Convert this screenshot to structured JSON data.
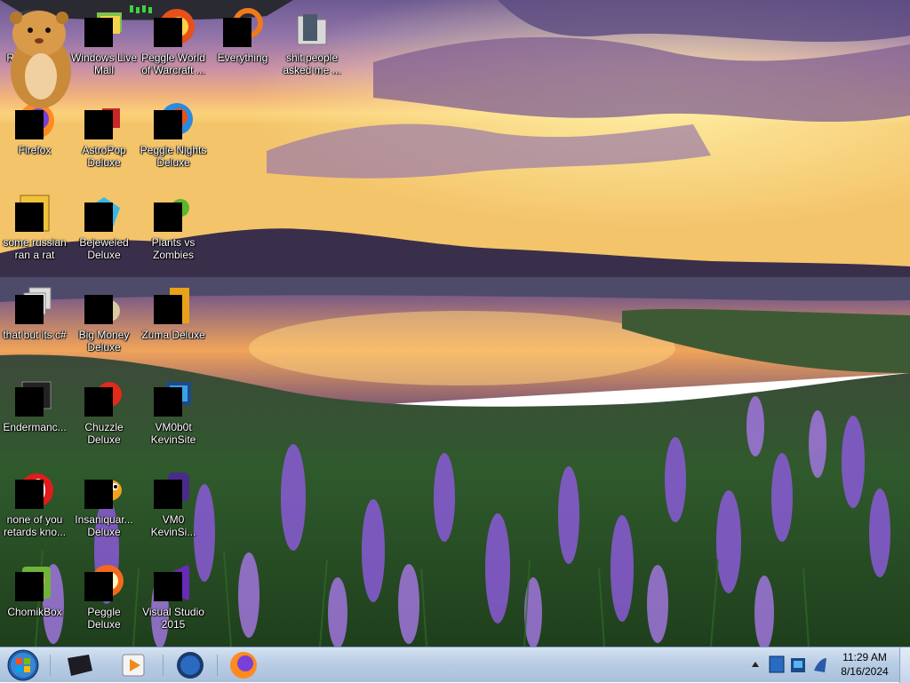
{
  "desktop": {
    "icons": [
      {
        "label": "Recycle Bin"
      },
      {
        "label": "Windows Live Mail"
      },
      {
        "label": "Peggle World of Warcraft ..."
      },
      {
        "label": "Everything"
      },
      {
        "label": "shit people asked me ..."
      },
      {
        "label": "Firefox"
      },
      {
        "label": "AstroPop Deluxe"
      },
      {
        "label": "Peggle Nights Deluxe"
      },
      {
        "label": "some russian ran a rat"
      },
      {
        "label": "Bejeweled Deluxe"
      },
      {
        "label": "Plants vs Zombies"
      },
      {
        "label": "that but its c#"
      },
      {
        "label": "Big Money Deluxe"
      },
      {
        "label": "Zuma Deluxe"
      },
      {
        "label": "Endermanc..."
      },
      {
        "label": "Chuzzle Deluxe"
      },
      {
        "label": "VM0b0t KevinSite"
      },
      {
        "label": "none of you retards kno..."
      },
      {
        "label": "Insaniquar... Deluxe"
      },
      {
        "label": "VM0 KevinSi..."
      },
      {
        "label": "ChomikBox"
      },
      {
        "label": "Peggle Deluxe"
      },
      {
        "label": "Visual Studio 2015"
      }
    ]
  },
  "taskbar": {
    "clock_time": "11:29 AM",
    "clock_date": "8/16/2024"
  },
  "colors": {
    "taskbar_top": "#d5e3f2",
    "taskbar_bottom": "#a9c0dc",
    "sky_top": "#6e5a93",
    "sunset": "#f6b64a",
    "lupine": "#8a5ad6"
  }
}
